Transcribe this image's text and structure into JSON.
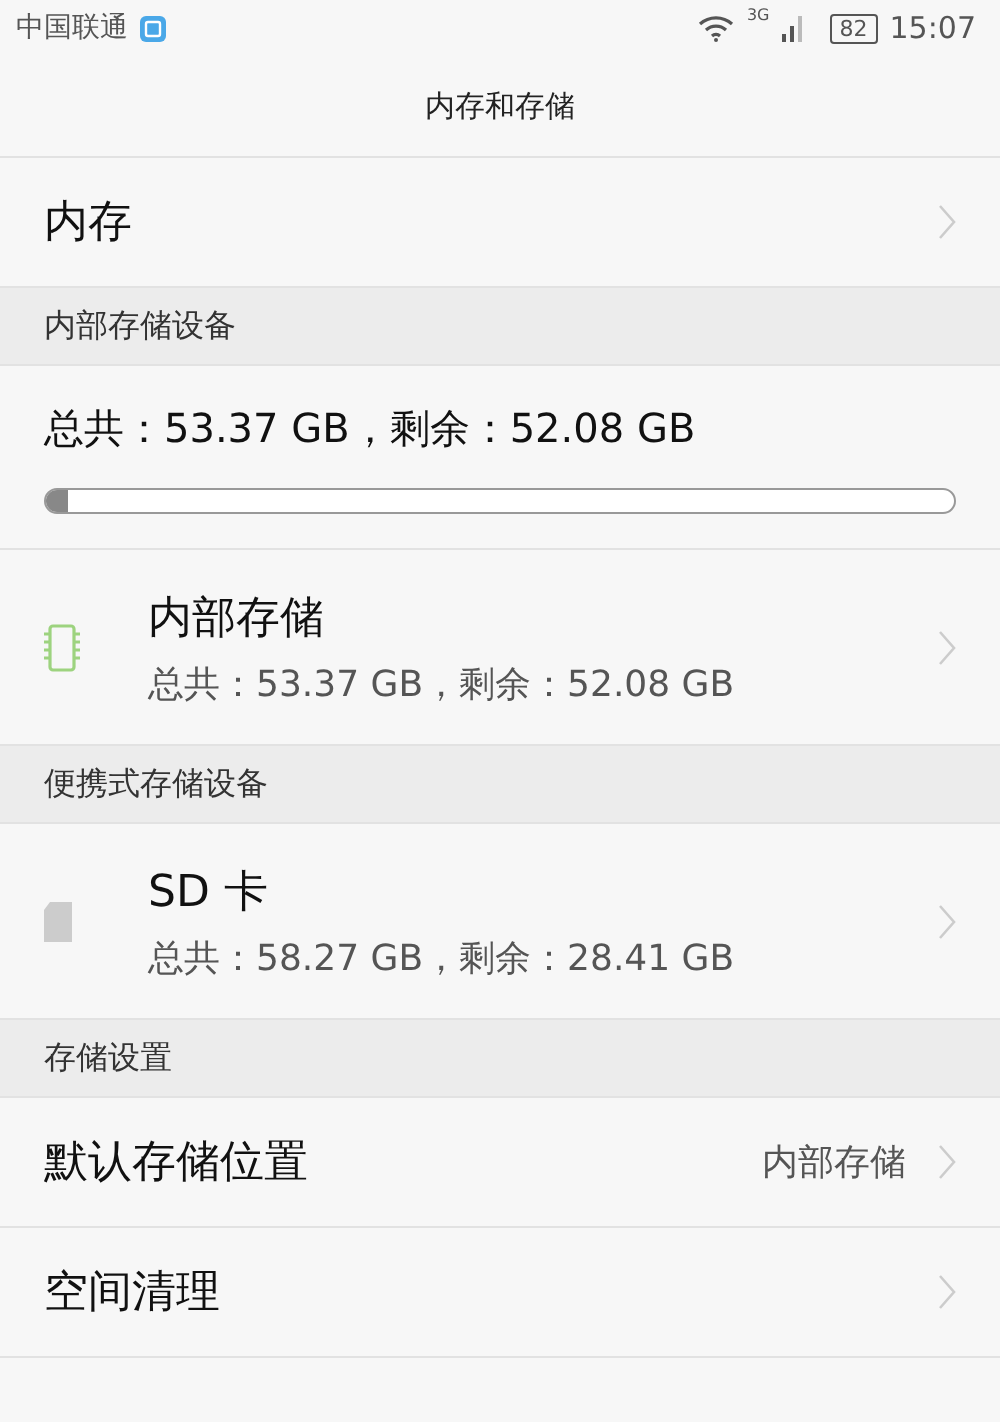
{
  "status_bar": {
    "carrier": "中国联通",
    "battery": "82",
    "network": "3G",
    "time": "15:07"
  },
  "title": "内存和存储",
  "sections": [
    {
      "kind": "nav",
      "label": "内存"
    },
    {
      "kind": "header",
      "label": "内部存储设备"
    },
    {
      "kind": "summary",
      "label": "总共：53.37 GB，剩余：52.08 GB",
      "level": 0.024
    },
    {
      "kind": "internal",
      "label": "内部存储",
      "detail": "总共：53.37 GB，剩余：52.08 GB"
    },
    {
      "kind": "header",
      "label": "便携式存储设备"
    },
    {
      "kind": "removable",
      "label": "SD 卡",
      "detail": "总共：58.27 GB，剩余：28.41 GB"
    },
    {
      "kind": "header",
      "label": "存储设置"
    },
    {
      "kind": "nav",
      "label": "默认存储位置",
      "value": "内部存储"
    },
    {
      "kind": "nav",
      "label": "空间清理"
    }
  ]
}
